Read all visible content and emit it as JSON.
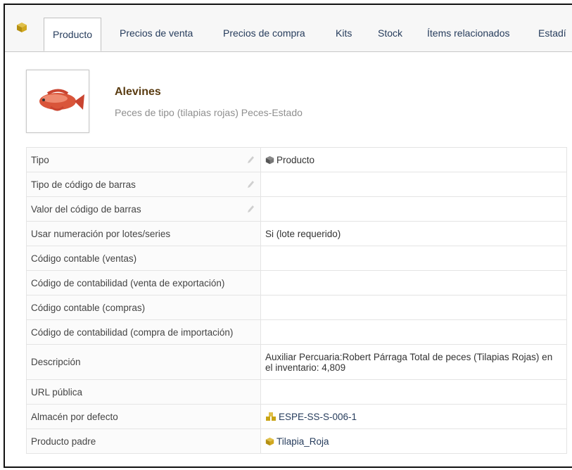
{
  "tabs": [
    {
      "label": "Producto",
      "active": true
    },
    {
      "label": "Precios de venta"
    },
    {
      "label": "Precios de compra"
    },
    {
      "label": "Kits"
    },
    {
      "label": "Stock"
    },
    {
      "label": "Ítems relacionados"
    },
    {
      "label": "Estadí"
    }
  ],
  "product": {
    "title": "Alevines",
    "subtitle": "Peces de tipo (tilapias rojas) Peces-Estado"
  },
  "rows": [
    {
      "label": "Tipo",
      "value": "Producto"
    },
    {
      "label": "Tipo de código de barras",
      "value": ""
    },
    {
      "label": "Valor del código de barras",
      "value": ""
    },
    {
      "label": "Usar numeración por lotes/series",
      "value": "Si (lote requerido)"
    },
    {
      "label": "Código contable (ventas)",
      "value": ""
    },
    {
      "label": "Código de contabilidad (venta de exportación)",
      "value": ""
    },
    {
      "label": "Código contable (compras)",
      "value": ""
    },
    {
      "label": "Código de contabilidad (compra de importación)",
      "value": ""
    },
    {
      "label": "Descripción",
      "value": "Auxiliar Percuaria:Robert Párraga  Total de peces (Tilapias Rojas) en el inventario: 4,809"
    },
    {
      "label": "URL pública",
      "value": ""
    },
    {
      "label": "Almacén por defecto",
      "value": "ESPE-SS-S-006-1"
    },
    {
      "label": "Producto padre",
      "value": "Tilapia_Roja"
    }
  ],
  "colors": {
    "accent_green": "#8cc63f",
    "link": "#263c5c",
    "cube_gold": "#c8a415"
  }
}
